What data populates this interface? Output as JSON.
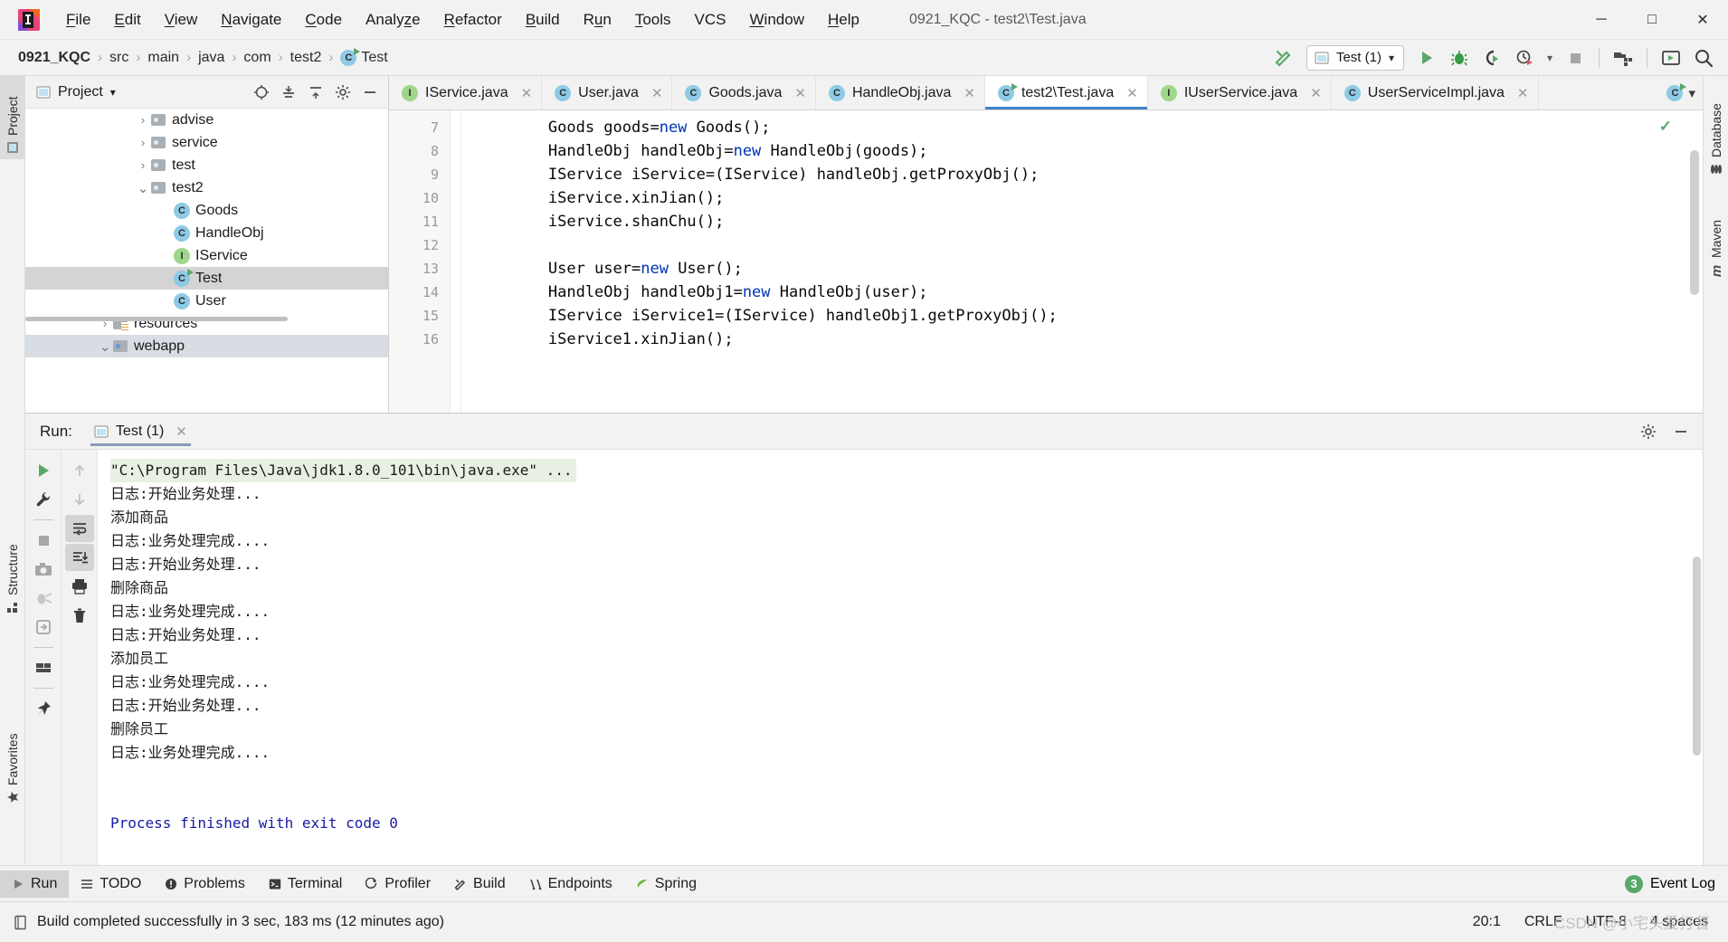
{
  "window": {
    "title": "0921_KQC - test2\\Test.java",
    "controls": {
      "minimize": "─",
      "maximize": "□",
      "close": "✕"
    }
  },
  "menu": [
    {
      "label": "File",
      "mnemonic": "F"
    },
    {
      "label": "Edit",
      "mnemonic": "E"
    },
    {
      "label": "View",
      "mnemonic": "V"
    },
    {
      "label": "Navigate",
      "mnemonic": "N"
    },
    {
      "label": "Code",
      "mnemonic": "C"
    },
    {
      "label": "Analyze",
      "mnemonic": "z"
    },
    {
      "label": "Refactor",
      "mnemonic": "R"
    },
    {
      "label": "Build",
      "mnemonic": "B"
    },
    {
      "label": "Run",
      "mnemonic": "u"
    },
    {
      "label": "Tools",
      "mnemonic": "T"
    },
    {
      "label": "VCS",
      "mnemonic": ""
    },
    {
      "label": "Window",
      "mnemonic": "W"
    },
    {
      "label": "Help",
      "mnemonic": "H"
    }
  ],
  "navbar": {
    "breadcrumbs": [
      {
        "label": "0921_KQC",
        "icon": ""
      },
      {
        "label": "src",
        "icon": ""
      },
      {
        "label": "main",
        "icon": ""
      },
      {
        "label": "java",
        "icon": ""
      },
      {
        "label": "com",
        "icon": ""
      },
      {
        "label": "test2",
        "icon": ""
      },
      {
        "label": "Test",
        "icon": "class-icon"
      }
    ],
    "separator": "›",
    "build_icon": "hammer-icon",
    "run_config": {
      "label": "Test (1)",
      "icon": "run-config-icon",
      "chevron": "▾"
    },
    "actions": [
      {
        "name": "run-button",
        "icon": "play-icon"
      },
      {
        "name": "debug-button",
        "icon": "bug-icon"
      },
      {
        "name": "run-with-coverage-button",
        "icon": "coverage-icon"
      },
      {
        "name": "profile-button",
        "icon": "profiler-icon"
      },
      {
        "name": "stop-button",
        "icon": "stop-icon"
      },
      {
        "name": "update-project-button",
        "icon": "update-folder-icon"
      },
      {
        "name": "select-opened-file-button",
        "icon": "screen-icon"
      },
      {
        "name": "search-everywhere-button",
        "icon": "search-icon"
      }
    ]
  },
  "left_strip": {
    "tabs": [
      {
        "label": "Project",
        "active": true,
        "icon": "project-icon"
      },
      {
        "label": "Structure",
        "active": false,
        "icon": "structure-icon"
      },
      {
        "label": "Favorites",
        "active": false,
        "icon": "star-icon"
      }
    ]
  },
  "right_strip": {
    "tabs": [
      {
        "label": "Database",
        "icon": "database-icon"
      },
      {
        "label": "Maven",
        "icon": "maven-icon"
      }
    ]
  },
  "project_pane": {
    "title": "Project",
    "title_chevron": "▾",
    "actions": [
      {
        "name": "scroll-from-source-button",
        "icon": "target-icon"
      },
      {
        "name": "expand-all-button",
        "icon": "expand-all-icon"
      },
      {
        "name": "collapse-all-button",
        "icon": "collapse-all-icon"
      },
      {
        "name": "settings-button",
        "icon": "gear-icon"
      },
      {
        "name": "hide-button",
        "icon": "minus-icon"
      }
    ],
    "tree": [
      {
        "label": "advise",
        "type": "folder",
        "indent": 5,
        "twisty": "›",
        "selected": false
      },
      {
        "label": "service",
        "type": "folder",
        "indent": 5,
        "twisty": "›",
        "selected": false
      },
      {
        "label": "test",
        "type": "folder",
        "indent": 5,
        "twisty": "›",
        "selected": false
      },
      {
        "label": "test2",
        "type": "folder",
        "indent": 5,
        "twisty": "⌄",
        "selected": false
      },
      {
        "label": "Goods",
        "type": "class",
        "indent": 6,
        "twisty": "",
        "selected": false
      },
      {
        "label": "HandleObj",
        "type": "class",
        "indent": 6,
        "twisty": "",
        "selected": false
      },
      {
        "label": "IService",
        "type": "interface",
        "indent": 6,
        "twisty": "",
        "selected": false
      },
      {
        "label": "Test",
        "type": "runclass",
        "indent": 6,
        "twisty": "",
        "selected": true
      },
      {
        "label": "User",
        "type": "class",
        "indent": 6,
        "twisty": "",
        "selected": false
      },
      {
        "label": "resources",
        "type": "resources",
        "indent": 3,
        "twisty": "›",
        "selected": false
      },
      {
        "label": "webapp",
        "type": "webapp",
        "indent": 3,
        "twisty": "⌄",
        "selected": false
      }
    ]
  },
  "editor": {
    "tabs": [
      {
        "label": "IService.java",
        "type": "interface",
        "active": false,
        "close": "✕"
      },
      {
        "label": "User.java",
        "type": "class",
        "active": false,
        "close": "✕"
      },
      {
        "label": "Goods.java",
        "type": "class",
        "active": false,
        "close": "✕"
      },
      {
        "label": "HandleObj.java",
        "type": "class",
        "active": false,
        "close": "✕"
      },
      {
        "label": "test2\\Test.java",
        "type": "runclass",
        "active": true,
        "close": "✕"
      },
      {
        "label": "IUserService.java",
        "type": "interface",
        "active": false,
        "close": "✕"
      },
      {
        "label": "UserServiceImpl.java",
        "type": "class",
        "active": false,
        "close": "✕"
      }
    ],
    "overflow_icon": "chevron-down-icon",
    "inspection_status": "✓",
    "lines": [
      {
        "num": "7",
        "segments": [
          {
            "t": "        Goods goods=",
            "k": false
          },
          {
            "t": "new",
            "k": true
          },
          {
            "t": " Goods();",
            "k": false
          }
        ]
      },
      {
        "num": "8",
        "segments": [
          {
            "t": "        HandleObj handleObj=",
            "k": false
          },
          {
            "t": "new",
            "k": true
          },
          {
            "t": " HandleObj(goods);",
            "k": false
          }
        ]
      },
      {
        "num": "9",
        "segments": [
          {
            "t": "        IService iService=(IService) handleObj.getProxyObj();",
            "k": false
          }
        ]
      },
      {
        "num": "10",
        "segments": [
          {
            "t": "        iService.xinJian();",
            "k": false
          }
        ]
      },
      {
        "num": "11",
        "segments": [
          {
            "t": "        iService.shanChu();",
            "k": false
          }
        ]
      },
      {
        "num": "12",
        "segments": [
          {
            "t": "",
            "k": false
          }
        ]
      },
      {
        "num": "13",
        "segments": [
          {
            "t": "        User user=",
            "k": false
          },
          {
            "t": "new",
            "k": true
          },
          {
            "t": " User();",
            "k": false
          }
        ]
      },
      {
        "num": "14",
        "segments": [
          {
            "t": "        HandleObj handleObj1=",
            "k": false
          },
          {
            "t": "new",
            "k": true
          },
          {
            "t": " HandleObj(user);",
            "k": false
          }
        ]
      },
      {
        "num": "15",
        "segments": [
          {
            "t": "        IService iService1=(IService) handleObj1.getProxyObj();",
            "k": false
          }
        ]
      },
      {
        "num": "16",
        "segments": [
          {
            "t": "        iService1.xinJian();",
            "k": false
          }
        ]
      }
    ]
  },
  "run_panel": {
    "label": "Run:",
    "tab": {
      "label": "Test (1)",
      "icon": "run-config-icon",
      "close": "✕"
    },
    "header_actions": [
      {
        "name": "run-settings-button",
        "icon": "gear-icon"
      },
      {
        "name": "hide-run-panel-button",
        "icon": "minus-icon"
      }
    ],
    "left_tools": [
      {
        "name": "rerun-button",
        "icon": "play-icon"
      },
      {
        "name": "edit-configuration-button",
        "icon": "wrench-icon"
      },
      {
        "name": "stop-button",
        "icon": "stop-icon"
      },
      {
        "name": "screenshot-button",
        "icon": "camera-icon"
      },
      {
        "name": "dump-threads-button",
        "icon": "threaddump-icon"
      },
      {
        "name": "exit-button",
        "icon": "exit-icon"
      },
      {
        "name": "layout-button",
        "icon": "layout-icon"
      },
      {
        "name": "pin-tab-button",
        "icon": "pin-icon"
      }
    ],
    "right_tools": [
      {
        "name": "up-button",
        "icon": "arrow-up-icon"
      },
      {
        "name": "down-button",
        "icon": "arrow-down-icon"
      },
      {
        "name": "soft-wrap-button",
        "icon": "softwrap-icon",
        "toggled": true
      },
      {
        "name": "scroll-to-end-button",
        "icon": "scroll-end-icon",
        "toggled": true
      },
      {
        "name": "print-button",
        "icon": "print-icon"
      },
      {
        "name": "clear-all-button",
        "icon": "trash-icon"
      }
    ],
    "console": [
      {
        "text": "\"C:\\Program Files\\Java\\jdk1.8.0_101\\bin\\java.exe\" ...",
        "style": "cmd"
      },
      {
        "text": "日志:开始业务处理...",
        "style": "normal"
      },
      {
        "text": "添加商品",
        "style": "normal"
      },
      {
        "text": "日志:业务处理完成....",
        "style": "normal"
      },
      {
        "text": "日志:开始业务处理...",
        "style": "normal"
      },
      {
        "text": "删除商品",
        "style": "normal"
      },
      {
        "text": "日志:业务处理完成....",
        "style": "normal"
      },
      {
        "text": "日志:开始业务处理...",
        "style": "normal"
      },
      {
        "text": "添加员工",
        "style": "normal"
      },
      {
        "text": "日志:业务处理完成....",
        "style": "normal"
      },
      {
        "text": "日志:开始业务处理...",
        "style": "normal"
      },
      {
        "text": "删除员工",
        "style": "normal"
      },
      {
        "text": "日志:业务处理完成....",
        "style": "normal"
      },
      {
        "text": "",
        "style": "normal"
      },
      {
        "text": "",
        "style": "normal"
      },
      {
        "text": "Process finished with exit code 0",
        "style": "blue"
      }
    ]
  },
  "bottom_bar": {
    "items": [
      {
        "label": "Run",
        "icon": "play-icon",
        "active": true
      },
      {
        "label": "TODO",
        "icon": "todo-icon",
        "active": false
      },
      {
        "label": "Problems",
        "icon": "problems-icon",
        "active": false
      },
      {
        "label": "Terminal",
        "icon": "terminal-icon",
        "active": false
      },
      {
        "label": "Profiler",
        "icon": "profiler-icon",
        "active": false
      },
      {
        "label": "Build",
        "icon": "hammer-icon",
        "active": false
      },
      {
        "label": "Endpoints",
        "icon": "endpoints-icon",
        "active": false
      },
      {
        "label": "Spring",
        "icon": "spring-icon",
        "active": false
      }
    ],
    "event_log": {
      "label": "Event Log",
      "count": "3"
    }
  },
  "status_bar": {
    "message": "Build completed successfully in 3 sec, 183 ms (12 minutes ago)",
    "message_icon": "book-icon",
    "caret_position": "20:1",
    "line_separator": "CRLF",
    "encoding": "UTF-8",
    "indent": "4 spaces",
    "watermark": "CSDN @小宅头爱打督"
  },
  "colors": {
    "accent_blue": "#4083c9",
    "green": "#59a869",
    "class_icon": "#8ecae6",
    "interface_icon": "#9fd68a",
    "console_cmd_bg": "#e7f0e2",
    "console_blue": "#1a1aa6",
    "selection_gray": "#d4d4d4"
  }
}
